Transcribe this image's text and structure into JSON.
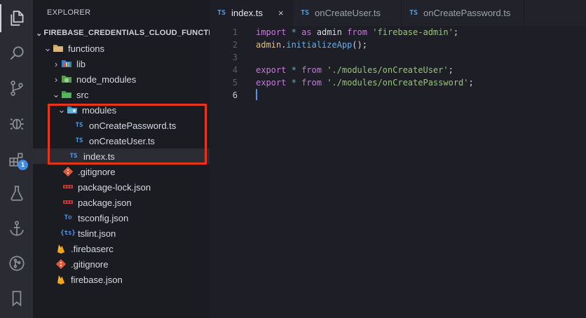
{
  "explorer": {
    "title": "EXPLORER",
    "root": "FIREBASE_CREDENTIALS_CLOUD_FUNCTI...",
    "items": [
      {
        "label": "functions",
        "depth": 1,
        "kind": "folder-open",
        "expanded": true
      },
      {
        "label": "lib",
        "depth": 2,
        "kind": "folder-lib",
        "expanded": false
      },
      {
        "label": "node_modules",
        "depth": 2,
        "kind": "folder-node",
        "expanded": false
      },
      {
        "label": "src",
        "depth": 2,
        "kind": "folder-src",
        "expanded": true
      },
      {
        "label": "modules",
        "depth": 3,
        "kind": "folder-modules",
        "expanded": true
      },
      {
        "label": "onCreatePassword.ts",
        "depth": 4,
        "kind": "ts"
      },
      {
        "label": "onCreateUser.ts",
        "depth": 4,
        "kind": "ts"
      },
      {
        "label": "index.ts",
        "depth": 3,
        "kind": "ts",
        "selected": true
      },
      {
        "label": ".gitignore",
        "depth": 2,
        "kind": "git"
      },
      {
        "label": "package-lock.json",
        "depth": 2,
        "kind": "npm"
      },
      {
        "label": "package.json",
        "depth": 2,
        "kind": "npm"
      },
      {
        "label": "tsconfig.json",
        "depth": 2,
        "kind": "tsconfig"
      },
      {
        "label": "tslint.json",
        "depth": 2,
        "kind": "tslint"
      },
      {
        "label": ".firebaserc",
        "depth": 1,
        "kind": "firebase"
      },
      {
        "label": ".gitignore",
        "depth": 1,
        "kind": "git"
      },
      {
        "label": "firebase.json",
        "depth": 1,
        "kind": "firebase"
      }
    ]
  },
  "tabs": [
    {
      "icon": "TS",
      "label": "index.ts",
      "active": true,
      "close": "×"
    },
    {
      "icon": "TS",
      "label": "onCreateUser.ts",
      "active": false
    },
    {
      "icon": "TS",
      "label": "onCreatePassword.ts",
      "active": false
    }
  ],
  "editor": {
    "line_numbers": [
      "1",
      "2",
      "3",
      "4",
      "5",
      "6"
    ],
    "lines": [
      "import * as admin from 'firebase-admin';",
      "admin.initializeApp();",
      "",
      "export * from './modules/onCreateUser';",
      "export * from './modules/onCreatePassword';",
      ""
    ],
    "active_line": 6
  },
  "activity_bar": {
    "icons": [
      "explorer-icon",
      "search-icon",
      "source-control-icon",
      "debug-icon",
      "extensions-icon",
      "testing-icon",
      "anchor-icon",
      "git-graph-icon",
      "bookmark-icon"
    ],
    "extensions_badge": "1"
  },
  "colors": {
    "accent_red": "#e8341c",
    "ts_blue": "#4d9ee9",
    "keyword": "#c678dd",
    "string": "#98c379"
  }
}
